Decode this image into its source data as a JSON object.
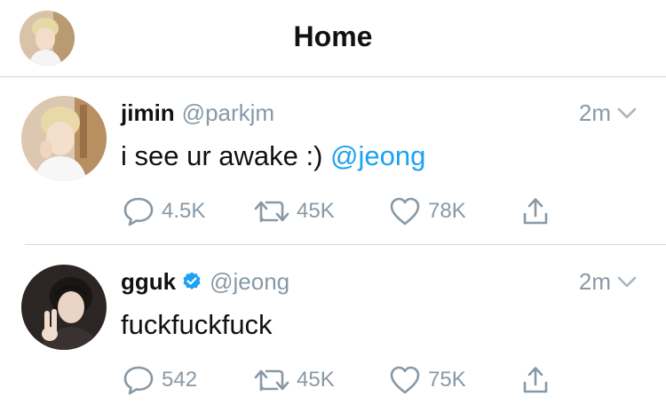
{
  "header": {
    "title": "Home"
  },
  "tweets": [
    {
      "name": "jimin",
      "handle": "@parkjm",
      "verified": false,
      "time": "2m",
      "text": "i see ur awake :) ",
      "mention": "@jeong",
      "replies": "4.5K",
      "retweets": "45K",
      "likes": "78K"
    },
    {
      "name": "gguk",
      "handle": "@jeong",
      "verified": true,
      "time": "2m",
      "text": "fuckfuckfuck",
      "mention": "",
      "replies": "542",
      "retweets": "45K",
      "likes": "75K"
    }
  ],
  "colors": {
    "accent": "#1da1f2",
    "muted": "#8899a6",
    "divider": "#d6dde2"
  },
  "icons": [
    "reply-icon",
    "retweet-icon",
    "like-icon",
    "share-icon",
    "chevron-down-icon",
    "verified-badge-icon"
  ]
}
